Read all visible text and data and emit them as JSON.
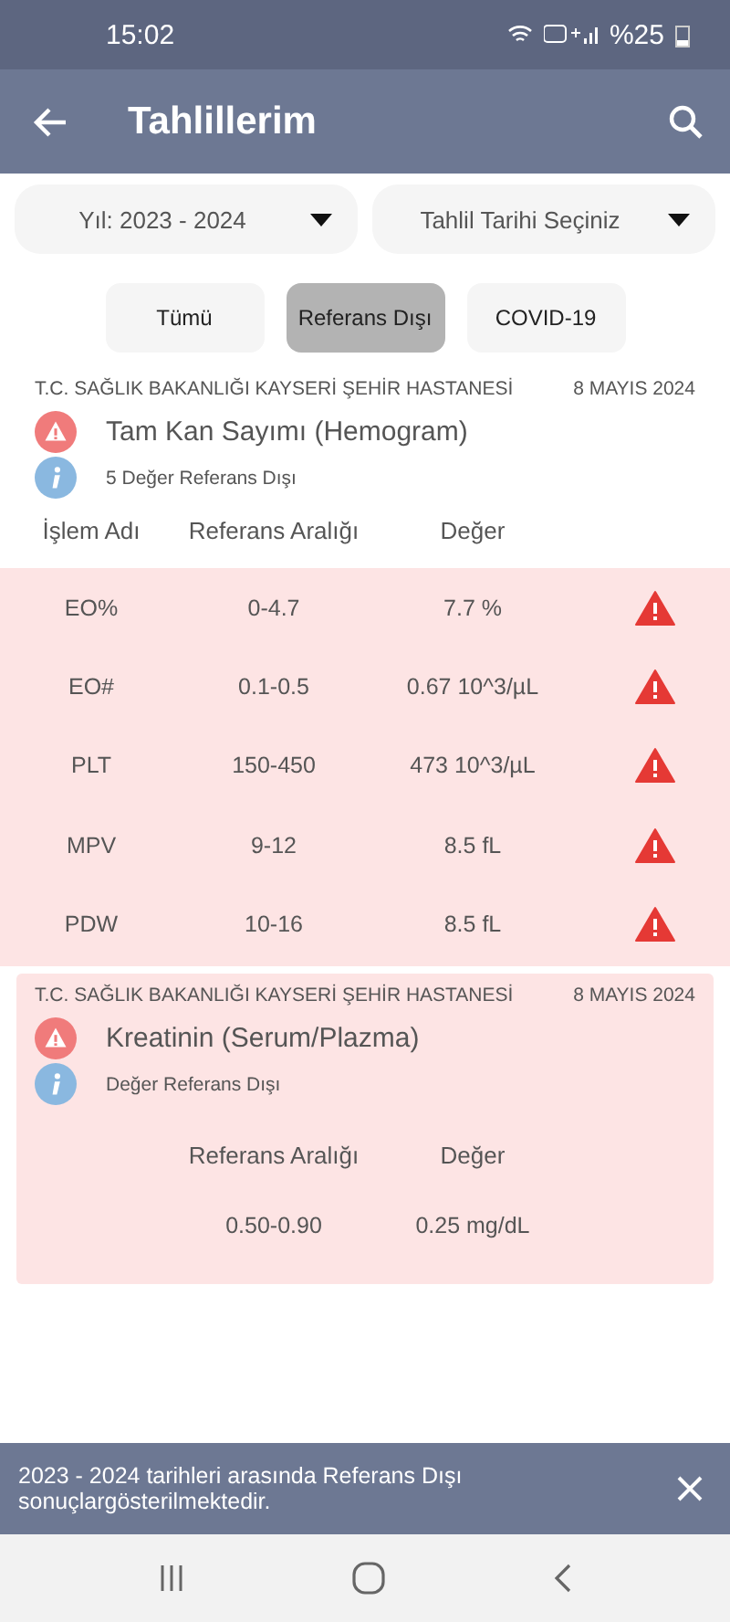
{
  "status_bar": {
    "time": "15:02",
    "battery": "%25"
  },
  "app_bar": {
    "title": "Tahlillerim"
  },
  "filters": [
    {
      "label": "Yıl: 2023 - 2024"
    },
    {
      "label": "Tahlil Tarihi Seçiniz"
    }
  ],
  "tabs": [
    {
      "label": "Tümü",
      "selected": false
    },
    {
      "label": "Referans Dışı",
      "selected": true
    },
    {
      "label": "COVID-19",
      "selected": false
    }
  ],
  "results": [
    {
      "kind": "table",
      "hospital": "T.C. SAĞLIK BAKANLIĞI KAYSERİ ŞEHİR HASTANESİ",
      "date": "8 MAYIS 2024",
      "test": "Tam Kan Sayımı (Hemogram)",
      "note": "5 Değer Referans Dışı",
      "columns": [
        "İşlem Adı",
        "Referans Aralığı",
        "Değer"
      ],
      "rows": [
        {
          "name": "EO%",
          "range": "0-4.7",
          "value": "7.7 %",
          "out_of_range": true
        },
        {
          "name": "EO#",
          "range": "0.1-0.5",
          "value": "0.67 10^3/µL",
          "out_of_range": true
        },
        {
          "name": "PLT",
          "range": "150-450",
          "value": "473 10^3/µL",
          "out_of_range": true
        },
        {
          "name": "MPV",
          "range": "9-12",
          "value": "8.5 fL",
          "out_of_range": true
        },
        {
          "name": "PDW",
          "range": "10-16",
          "value": "8.5 fL",
          "out_of_range": true
        }
      ]
    },
    {
      "kind": "single",
      "hospital": "T.C. SAĞLIK BAKANLIĞI KAYSERİ ŞEHİR HASTANESİ",
      "date": "8 MAYIS 2024",
      "test": "Kreatinin (Serum/Plazma)",
      "note": "Değer Referans Dışı",
      "columns": [
        "Referans Aralığı",
        "Değer"
      ],
      "rows": [
        {
          "range": "0.50-0.90",
          "value": "0.25 mg/dL"
        }
      ]
    }
  ],
  "toast": {
    "message": "2023 - 2024 tarihleri arasında Referans Dışı sonuçlargösterilmektedir."
  }
}
